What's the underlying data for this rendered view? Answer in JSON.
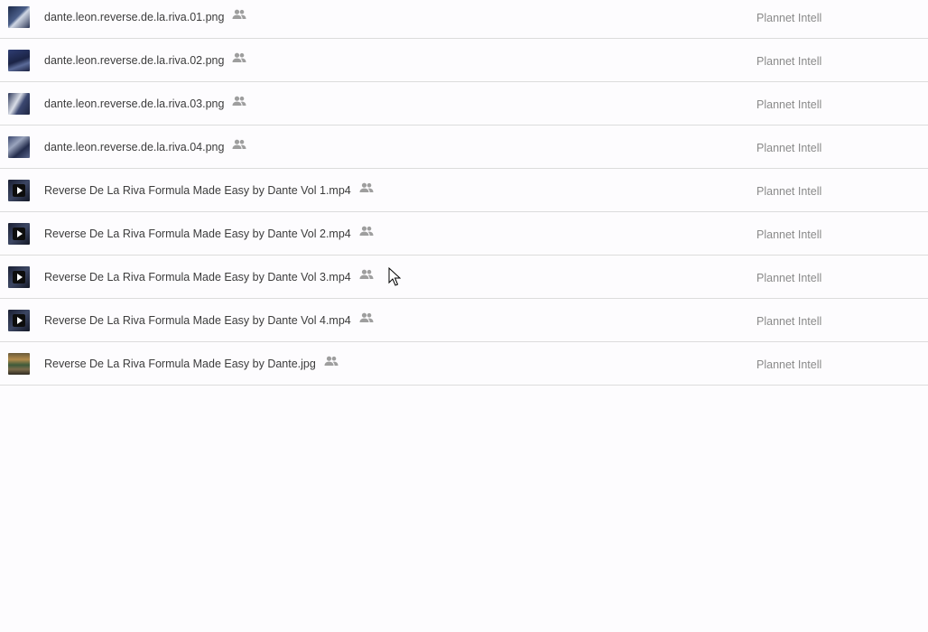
{
  "files": [
    {
      "name": "dante.leon.reverse.de.la.riva.01.png",
      "owner": "Plannet Intell",
      "type": "image",
      "thumb": "img-1"
    },
    {
      "name": "dante.leon.reverse.de.la.riva.02.png",
      "owner": "Plannet Intell",
      "type": "image",
      "thumb": "img-2"
    },
    {
      "name": "dante.leon.reverse.de.la.riva.03.png",
      "owner": "Plannet Intell",
      "type": "image",
      "thumb": "img-3"
    },
    {
      "name": "dante.leon.reverse.de.la.riva.04.png",
      "owner": "Plannet Intell",
      "type": "image",
      "thumb": "img-4"
    },
    {
      "name": "Reverse De La Riva Formula Made Easy by Dante Vol 1.mp4",
      "owner": "Plannet Intell",
      "type": "video",
      "thumb": "video"
    },
    {
      "name": "Reverse De La Riva Formula Made Easy by Dante Vol 2.mp4",
      "owner": "Plannet Intell",
      "type": "video",
      "thumb": "video"
    },
    {
      "name": "Reverse De La Riva Formula Made Easy by Dante Vol 3.mp4",
      "owner": "Plannet Intell",
      "type": "video",
      "thumb": "video"
    },
    {
      "name": "Reverse De La Riva Formula Made Easy by Dante Vol 4.mp4",
      "owner": "Plannet Intell",
      "type": "video",
      "thumb": "video"
    },
    {
      "name": "Reverse De La Riva Formula Made Easy by Dante.jpg",
      "owner": "Plannet Intell",
      "type": "image",
      "thumb": "jpg"
    }
  ],
  "icons": {
    "shared": "shared-people-icon",
    "play": "play-icon"
  },
  "colors": {
    "background": "#fdfcfe",
    "divider": "#dcdcdc",
    "filename_text": "#3c3c3c",
    "owner_text": "#8a8a8a",
    "shared_icon": "#9e9e9e"
  }
}
